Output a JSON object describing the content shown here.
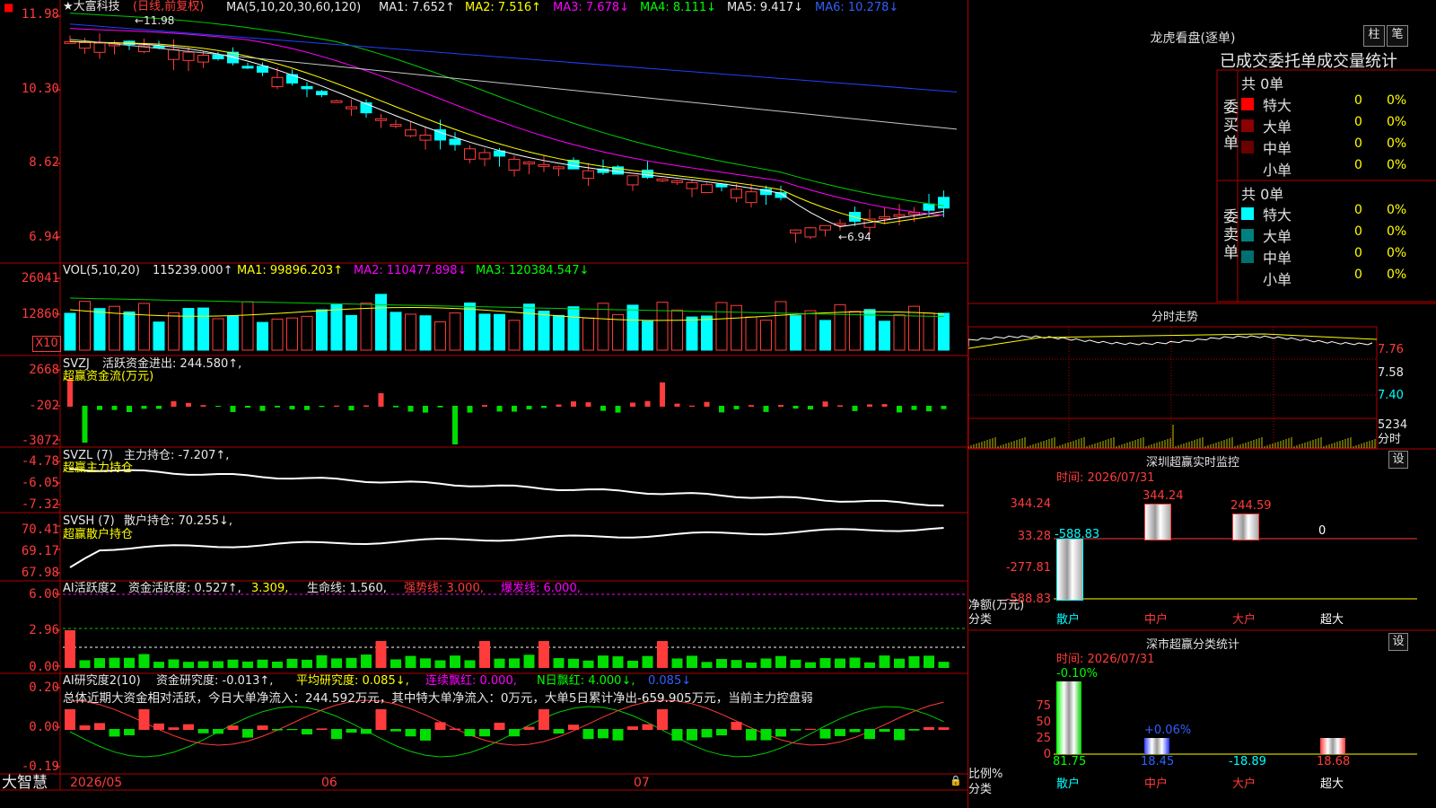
{
  "stock": {
    "title": "★大富科技",
    "period": "(日线,前复权)",
    "ma_label": "MA(5,10,20,30,60,120)",
    "ma1": "MA1: 7.652↑",
    "ma2": "MA2: 7.516↑",
    "ma3": "MA3: 7.678↓",
    "ma4": "MA4: 8.111↓",
    "ma5": "MA5: 9.417↓",
    "ma6": "MA6: 10.278↓",
    "high_label": "←11.98",
    "low_label": "←6.94",
    "yaxis": [
      "11.98",
      "10.30",
      "8.62",
      "6.94"
    ]
  },
  "vol": {
    "label": "VOL(5,10,20)",
    "value": "115239.000↑",
    "ma1": "MA1: 99896.203↑",
    "ma2": "MA2: 110477.898↓",
    "ma3": "MA3: 120384.547↓",
    "yaxis": [
      "26041",
      "12860"
    ],
    "unit": "X10"
  },
  "svzj": {
    "label": "SVZJ",
    "desc": "活跃资金进出: 244.580↑,",
    "sub": "超赢资金流(万元)",
    "yaxis": [
      "2668",
      "-202",
      "-3072"
    ]
  },
  "svzl": {
    "label": "SVZL (7)",
    "desc": "主力持仓: -7.207↑,",
    "sub": "超赢主力持仓",
    "yaxis": [
      "-4.78",
      "-6.05",
      "-7.32"
    ]
  },
  "svsh": {
    "label": "SVSH (7)",
    "desc": "散户持仓: 70.255↓,",
    "sub": "超赢散户持仓",
    "yaxis": [
      "70.41",
      "69.17",
      "67.98"
    ]
  },
  "ai1": {
    "label": "AI活跃度2",
    "desc": "资金活跃度: 0.527↑,",
    "v2": "3.309,",
    "life": "生命线: 1.560,",
    "strong": "强势线: 3.000,",
    "burst": "爆发线: 6.000,",
    "yaxis": [
      "6.00",
      "2.96",
      "0.00"
    ]
  },
  "ai2": {
    "label": "AI研究度2(10)",
    "desc": "资金研究度: -0.013↑,",
    "avg": "平均研究度: 0.085↓,",
    "cont": "连续飘红: 0.000,",
    "nday": "N日飘红: 4.000↓,",
    "last": "0.085↓",
    "summary": "总体近期大资金相对活跃，今日大单净流入：244.592万元，其中特大单净流入：0万元，大单5日累计净出-659.905万元，当前主力控盘弱",
    "yaxis": [
      "0.20",
      "0.00",
      "-0.19"
    ]
  },
  "xaxis": {
    "brand": "大智慧",
    "labels": [
      "2026/05",
      "06",
      "07"
    ]
  },
  "lhb": {
    "title": "龙虎看盘(逐单)",
    "btn1": "柱",
    "btn2": "笔",
    "tabs": "已成交委托单成交量统计",
    "buy_title": "委买单",
    "sell_title": "委卖单",
    "buy_total": "共 0单",
    "sell_total": "共 0单",
    "buy_rows": [
      {
        "name": "特大",
        "count": "0",
        "pct": "0%",
        "color": "#ff0000"
      },
      {
        "name": "大单",
        "count": "0",
        "pct": "0%",
        "color": "#8b0000"
      },
      {
        "name": "中单",
        "count": "0",
        "pct": "0%",
        "color": "#6a0000"
      },
      {
        "name": "小单",
        "count": "0",
        "pct": "0%",
        "color": ""
      }
    ],
    "sell_rows": [
      {
        "name": "特大",
        "count": "0",
        "pct": "0%",
        "color": "#00ffff"
      },
      {
        "name": "大单",
        "count": "0",
        "pct": "0%",
        "color": "#008080"
      },
      {
        "name": "中单",
        "count": "0",
        "pct": "0%",
        "color": "#006f6f"
      },
      {
        "name": "小单",
        "count": "0",
        "pct": "0%",
        "color": ""
      }
    ]
  },
  "intraday": {
    "title": "分时走势",
    "yaxis": [
      "7.76",
      "7.58",
      "7.40"
    ],
    "vol_label": "5234",
    "vol_unit": "分时"
  },
  "sz_monitor": {
    "title": "深圳超赢实时监控",
    "btn": "设",
    "time": "时间: 2026/07/31",
    "yaxis": [
      "344.24",
      "33.28",
      "-277.81",
      "-588.83"
    ],
    "ylabel": "净额(万元)",
    "xlabel": "分类",
    "bars": [
      {
        "cat": "散户",
        "value": -588.83,
        "label": "-588.83"
      },
      {
        "cat": "中户",
        "value": 344.24,
        "label": "344.24"
      },
      {
        "cat": "大户",
        "value": 244.59,
        "label": "244.59"
      },
      {
        "cat": "超大",
        "value": 0,
        "label": "0"
      }
    ]
  },
  "sz_class": {
    "title": "深市超赢分类统计",
    "btn": "设",
    "time": "时间: 2026/07/31",
    "yaxis": [
      "75",
      "50",
      "25",
      "0"
    ],
    "ylabel": "比例%",
    "xlabel": "分类",
    "bars": [
      {
        "cat": "散户",
        "value": 81.75,
        "top": "-0.10%"
      },
      {
        "cat": "中户",
        "value": 18.45,
        "top": "+0.06%"
      },
      {
        "cat": "大户",
        "value": -18.89,
        "top": ""
      },
      {
        "cat": "超大",
        "value": 18.68,
        "top": ""
      }
    ]
  },
  "colors": {
    "up": "#ff3b3b",
    "down": "#00ffff",
    "border": "#b00000"
  }
}
